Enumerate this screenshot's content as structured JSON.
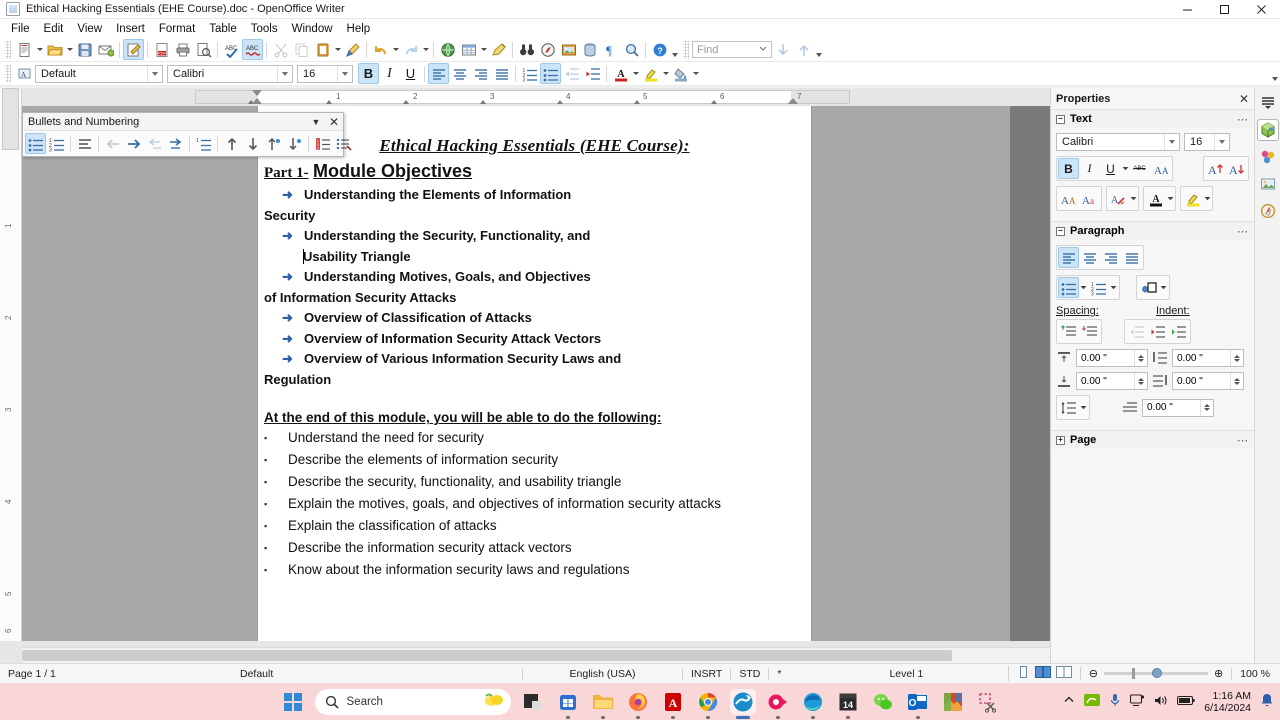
{
  "window": {
    "title": "Ethical Hacking Essentials (EHE Course).doc - OpenOffice Writer",
    "app_icon": "writer-document-icon",
    "minimize_label": "Minimize",
    "maximize_label": "Maximize",
    "close_label": "Close"
  },
  "menubar": {
    "items": [
      {
        "label": "File"
      },
      {
        "label": "Edit"
      },
      {
        "label": "View"
      },
      {
        "label": "Insert"
      },
      {
        "label": "Format"
      },
      {
        "label": "Table"
      },
      {
        "label": "Tools"
      },
      {
        "label": "Window"
      },
      {
        "label": "Help"
      }
    ]
  },
  "standard_toolbar": {
    "buttons": [
      {
        "name": "new-document",
        "icon": "new-doc-icon"
      },
      {
        "name": "open-document",
        "icon": "open-folder-icon"
      },
      {
        "name": "save-document",
        "icon": "save-floppy-icon"
      },
      {
        "name": "email-document",
        "icon": "email-icon"
      },
      {
        "name": "edit-file",
        "icon": "edit-pencil-icon"
      },
      {
        "name": "export-pdf",
        "icon": "pdf-icon"
      },
      {
        "name": "print-document",
        "icon": "printer-icon"
      },
      {
        "name": "print-preview",
        "icon": "print-preview-icon"
      },
      {
        "name": "spelling",
        "icon": "abc-check-icon"
      },
      {
        "name": "autospellcheck",
        "icon": "abc-red-icon"
      },
      {
        "name": "cut",
        "icon": "scissors-icon"
      },
      {
        "name": "copy",
        "icon": "copy-icon"
      },
      {
        "name": "paste",
        "icon": "clipboard-icon"
      },
      {
        "name": "clone-formatting",
        "icon": "paintbrush-icon"
      },
      {
        "name": "undo",
        "icon": "undo-arrow-icon"
      },
      {
        "name": "redo",
        "icon": "redo-arrow-icon"
      },
      {
        "name": "hyperlink",
        "icon": "globe-icon"
      },
      {
        "name": "insert-table",
        "icon": "table-grid-icon"
      },
      {
        "name": "show-draw-functions",
        "icon": "draw-pencil-icon"
      },
      {
        "name": "find-and-replace",
        "icon": "binoculars-icon"
      },
      {
        "name": "navigator",
        "icon": "compass-icon"
      },
      {
        "name": "gallery",
        "icon": "gallery-image-icon"
      },
      {
        "name": "data-sources",
        "icon": "database-icon"
      },
      {
        "name": "formatting-marks",
        "icon": "pilcrow-icon"
      },
      {
        "name": "zoom",
        "icon": "magnifier-icon"
      },
      {
        "name": "help",
        "icon": "help-question-icon"
      }
    ],
    "find": {
      "placeholder": "Find",
      "value": "",
      "find-previous": "find-previous-icon",
      "find-next": "find-next-icon"
    }
  },
  "formatting_toolbar": {
    "paragraph_style": "Default",
    "font_name": "Calibri",
    "font_size": "16",
    "buttons": [
      {
        "name": "bold",
        "label": "B",
        "active": true
      },
      {
        "name": "italic",
        "label": "I",
        "active": false
      },
      {
        "name": "underline",
        "label": "U",
        "active": false
      },
      {
        "name": "align-left",
        "icon": "align-left-icon",
        "active": true
      },
      {
        "name": "align-center",
        "icon": "align-center-icon",
        "active": false
      },
      {
        "name": "align-right",
        "icon": "align-right-icon",
        "active": false
      },
      {
        "name": "justify",
        "icon": "align-justify-icon",
        "active": false
      },
      {
        "name": "numbered-list",
        "icon": "numbered-list-icon",
        "active": false
      },
      {
        "name": "bulleted-list",
        "icon": "bulleted-list-icon",
        "active": true
      },
      {
        "name": "decrease-indent",
        "icon": "decrease-indent-icon",
        "active": false
      },
      {
        "name": "increase-indent",
        "icon": "increase-indent-icon",
        "active": false
      },
      {
        "name": "font-color",
        "icon": "font-color-icon",
        "active": false
      },
      {
        "name": "highlighting-color",
        "icon": "highlight-color-icon",
        "active": false
      },
      {
        "name": "background-color",
        "icon": "background-color-icon",
        "active": false
      }
    ]
  },
  "floating_toolbar": {
    "title": "Bullets and Numbering",
    "buttons": [
      {
        "name": "unordered-list",
        "icon": "bulleted-list-icon",
        "active": true
      },
      {
        "name": "ordered-list",
        "icon": "numbered-list-icon",
        "active": false
      },
      {
        "name": "no-list",
        "icon": "no-list-icon",
        "active": false
      },
      {
        "name": "promote",
        "icon": "arrow-left-icon",
        "disabled": true
      },
      {
        "name": "demote",
        "icon": "arrow-right-icon",
        "disabled": false
      },
      {
        "name": "promote-with-subpoints",
        "icon": "arrow-left-sub-icon",
        "disabled": true
      },
      {
        "name": "demote-with-subpoints",
        "icon": "arrow-right-sub-icon",
        "disabled": false
      },
      {
        "name": "insert-unnumbered-entry",
        "icon": "unnumbered-entry-icon",
        "disabled": false
      },
      {
        "name": "move-up",
        "icon": "arrow-up-icon",
        "disabled": false
      },
      {
        "name": "move-down",
        "icon": "arrow-down-icon",
        "disabled": false
      },
      {
        "name": "move-up-with-subpoints",
        "icon": "arrow-up-sub-icon",
        "disabled": false
      },
      {
        "name": "move-down-with-subpoints",
        "icon": "arrow-down-sub-icon",
        "disabled": false
      },
      {
        "name": "restart-numbering",
        "icon": "restart-numbering-icon",
        "disabled": false
      },
      {
        "name": "bullets-and-numbering-dialog",
        "icon": "list-settings-icon",
        "disabled": false
      }
    ]
  },
  "ruler": {
    "horizontal_numbers": [
      "1",
      "2",
      "3",
      "4",
      "5",
      "6",
      "7"
    ],
    "vertical_numbers": [
      "1",
      "2",
      "3",
      "4",
      "5",
      "6"
    ],
    "unit": "inch"
  },
  "document": {
    "title": "Ethical Hacking Essentials (EHE Course):",
    "heading_part": "Part 1-",
    "heading_module": "Module Objectives",
    "objectives": [
      {
        "line1": "Understanding the Elements of Information",
        "line2": "Security",
        "wrap_indent": false
      },
      {
        "line1": "Understanding the Security, Functionality, and",
        "line2": "Usability Triangle",
        "wrap_indent": true,
        "caret_before_line2": true
      },
      {
        "line1": "Understanding Motives, Goals, and Objectives",
        "line2": "of Information Security Attacks",
        "wrap_indent": false
      },
      {
        "line1": "Overview of Classification of Attacks",
        "line2": "",
        "wrap_indent": false
      },
      {
        "line1": "Overview of Information Security Attack Vectors",
        "line2": "",
        "wrap_indent": false
      },
      {
        "line1": "Overview of Various Information Security Laws and",
        "line2": "Regulation",
        "wrap_indent": false,
        "caret_in_line2_at": 9
      }
    ],
    "outcomes_heading": "At the end of this module, you will be able to do the following:",
    "outcomes": [
      "Understand the need for security",
      "Describe the elements of information security",
      "Describe the security, functionality, and usability triangle",
      "Explain the motives, goals, and objectives of information security attacks",
      "Explain the classification of attacks",
      "Describe the information security attack vectors",
      "Know about the information security laws and regulations"
    ],
    "bullet_glyph": "➜",
    "bullet_color": "#2f5fa8",
    "square_glyph": "▪"
  },
  "sidebar": {
    "title": "Properties",
    "close_label": "✕",
    "sections": [
      {
        "name": "text",
        "label": "Text",
        "expanded": true,
        "more": "⋯"
      },
      {
        "name": "paragraph",
        "label": "Paragraph",
        "expanded": true,
        "more": "⋯"
      },
      {
        "name": "page",
        "label": "Page",
        "expanded": false,
        "more": "⋯"
      }
    ],
    "text": {
      "font_name": "Calibri",
      "font_size": "16",
      "bold_active": true,
      "buttons": [
        {
          "name": "bold",
          "label": "B"
        },
        {
          "name": "italic",
          "label": "I"
        },
        {
          "name": "underline",
          "label": "U"
        },
        {
          "name": "strikethrough",
          "label": "ABC"
        },
        {
          "name": "superscript-subscript",
          "label": "Aa"
        },
        {
          "name": "increase-font-size",
          "label": "A↑"
        },
        {
          "name": "decrease-font-size",
          "label": "A↓"
        },
        {
          "name": "uppercase",
          "label": "A"
        },
        {
          "name": "lowercase",
          "label": "A"
        },
        {
          "name": "clear-formatting",
          "label": "A"
        },
        {
          "name": "font-color",
          "label": "A"
        },
        {
          "name": "highlighting-color",
          "label": "A"
        }
      ]
    },
    "paragraph": {
      "align_left_active": true,
      "list_bullet_active": true,
      "spacing_label": "Spacing:",
      "indent_label": "Indent:",
      "spacing_above": "0.00 \"",
      "spacing_below": "0.00 \"",
      "indent_before": "0.00 \"",
      "indent_after": "0.00 \"",
      "indent_first_line": "0.00 \"",
      "buttons": [
        {
          "name": "align-left"
        },
        {
          "name": "align-center"
        },
        {
          "name": "align-right"
        },
        {
          "name": "justify"
        },
        {
          "name": "unordered-list"
        },
        {
          "name": "ordered-list"
        },
        {
          "name": "paragraph-background"
        },
        {
          "name": "increase-spacing"
        },
        {
          "name": "decrease-spacing"
        },
        {
          "name": "increase-indent"
        },
        {
          "name": "decrease-indent"
        },
        {
          "name": "hanging-indent"
        },
        {
          "name": "line-spacing"
        }
      ]
    }
  },
  "rail": {
    "items": [
      {
        "name": "sidebar-settings",
        "icon": "sidebar-menu-icon",
        "selected": false
      },
      {
        "name": "properties-deck",
        "icon": "properties-cube-icon",
        "selected": true
      },
      {
        "name": "styles-deck",
        "icon": "styles-icon",
        "selected": false
      },
      {
        "name": "gallery-deck",
        "icon": "gallery-icon",
        "selected": false
      },
      {
        "name": "navigator-deck",
        "icon": "navigator-compass-icon",
        "selected": false
      }
    ]
  },
  "statusbar": {
    "page": "Page 1 / 1",
    "page_style": "Default",
    "language": "English (USA)",
    "insert_mode": "INSRT",
    "selection_mode": "STD",
    "modified": "*",
    "outline_level": "Level 1",
    "view_single": "single-page-view-icon",
    "view_multi": "multi-page-view-icon",
    "view_book": "book-view-icon",
    "zoom_out": "⊖",
    "zoom_in": "⊕",
    "zoom": "100 %"
  },
  "taskbar": {
    "start": "windows-start-icon",
    "search": {
      "placeholder": "Search",
      "value": "",
      "icon": "search-icon",
      "widget": "weather-lemon-icon"
    },
    "apps": [
      {
        "name": "file-explorer-dark",
        "icon": "folder-dark-icon",
        "color": "#2b2b2b",
        "running": false
      },
      {
        "name": "microsoft-store",
        "icon": "store-icon",
        "color": "#2f6fd0",
        "running": true
      },
      {
        "name": "file-explorer",
        "icon": "folder-icon",
        "color": "#f2b441",
        "running": true
      },
      {
        "name": "firefox",
        "icon": "firefox-icon",
        "color": "#ff7139",
        "running": true
      },
      {
        "name": "adobe-acrobat",
        "icon": "acrobat-icon",
        "color": "#cc0000",
        "running": true
      },
      {
        "name": "google-chrome",
        "icon": "chrome-icon",
        "color": "#4285f4",
        "running": true
      },
      {
        "name": "openoffice-writer",
        "icon": "openoffice-icon",
        "color": "#1a8ccc",
        "running": true,
        "active": true
      },
      {
        "name": "screen-recorder",
        "icon": "record-icon",
        "color": "#e8175d",
        "running": true
      },
      {
        "name": "microsoft-edge",
        "icon": "edge-icon",
        "color": "#0f7bc4",
        "running": true
      },
      {
        "name": "calendar",
        "icon": "calendar-14-icon",
        "color": "#2b2b2b",
        "running": true
      },
      {
        "name": "wechat",
        "icon": "wechat-icon",
        "color": "#4ec820",
        "running": false
      },
      {
        "name": "outlook",
        "icon": "outlook-icon",
        "color": "#0a66c2",
        "running": true
      },
      {
        "name": "photos",
        "icon": "photos-icon",
        "color": "#d14b28",
        "running": false
      },
      {
        "name": "snipping-tool",
        "icon": "snipping-tool-icon",
        "color": "#c94f7c",
        "running": false
      }
    ],
    "tray": {
      "chevron": "show-hidden-icons-chevron",
      "items": [
        {
          "name": "nvidia-tray-icon"
        },
        {
          "name": "microphone-icon"
        },
        {
          "name": "display-icon"
        },
        {
          "name": "volume-icon"
        },
        {
          "name": "battery-icon"
        }
      ],
      "time": "1:16 AM",
      "date": "6/14/2024",
      "notifications": "notification-bell-icon"
    }
  },
  "colors": {
    "accent_blue": "#cce4f7",
    "accent_border": "#9cc8ec",
    "taskbar_bg": "#f9d7d9",
    "bullet_blue": "#2f5fa8",
    "page_bg": "#a8a8a8"
  }
}
